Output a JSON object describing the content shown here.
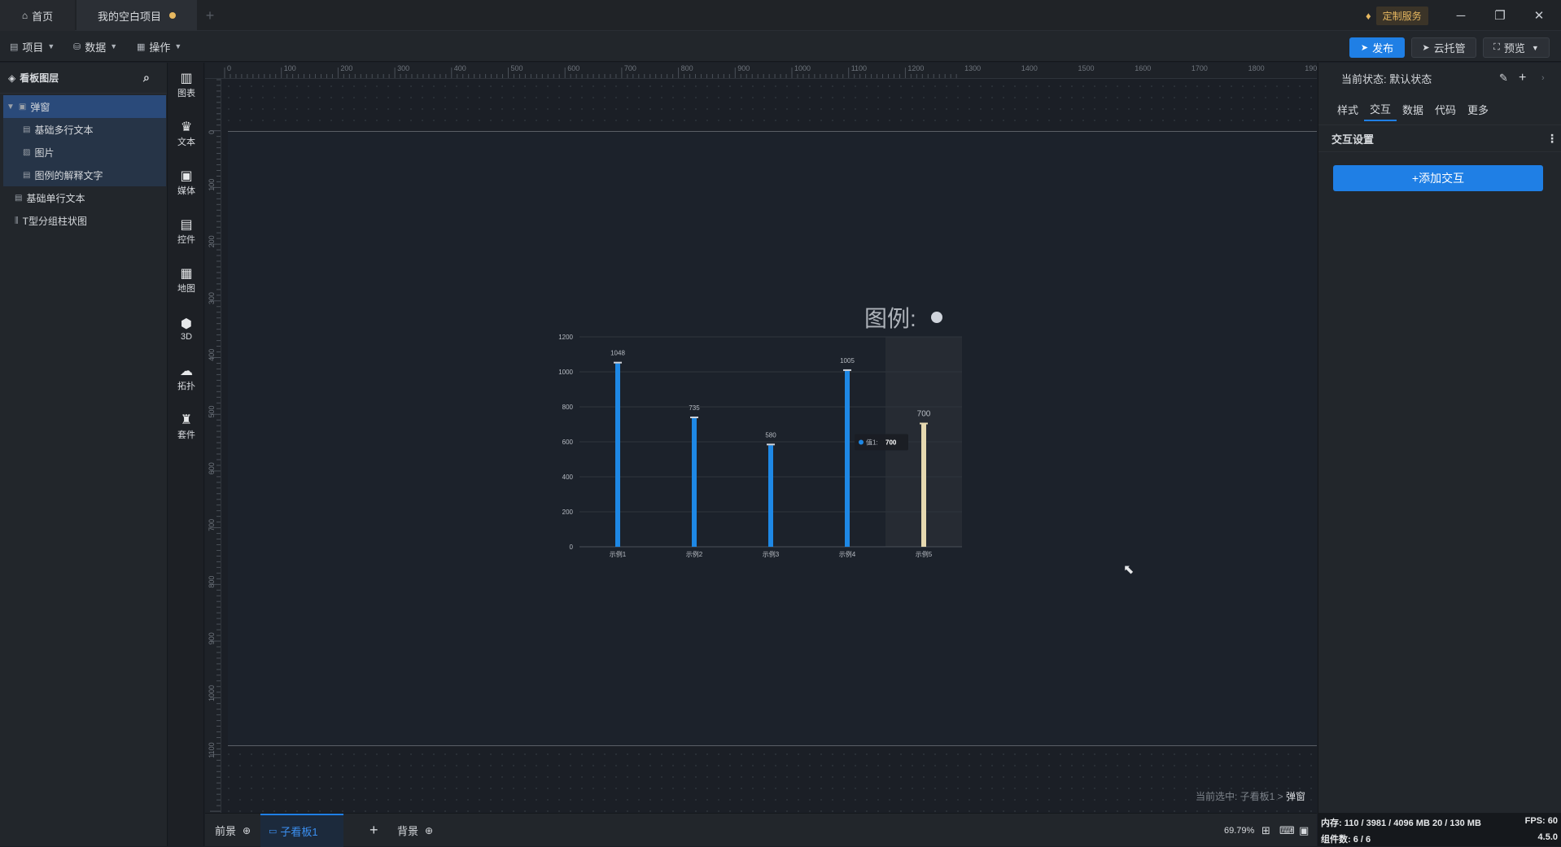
{
  "titlebar": {
    "home_label": "首页",
    "project_label": "我的空白项目",
    "add_tab": "+",
    "vip_label": "定制服务",
    "minimize": "─",
    "restore": "❐",
    "close": "✕"
  },
  "toolbar": {
    "menu_project": "项目",
    "menu_data": "数据",
    "menu_ops": "操作",
    "publish": "发布",
    "cloud": "云托管",
    "preview": "预览"
  },
  "layers": {
    "title": "看板图层",
    "items": [
      {
        "label": "弹窗"
      },
      {
        "label": "基础多行文本"
      },
      {
        "label": "图片"
      },
      {
        "label": "图例的解释文字"
      },
      {
        "label": "基础单行文本"
      },
      {
        "label": "T型分组柱状图"
      }
    ]
  },
  "rail": [
    {
      "label": "图表",
      "icon": "bar-chart-icon"
    },
    {
      "label": "文本",
      "icon": "crown-icon"
    },
    {
      "label": "媒体",
      "icon": "media-icon"
    },
    {
      "label": "控件",
      "icon": "widget-icon"
    },
    {
      "label": "地图",
      "icon": "map-icon"
    },
    {
      "label": "3D",
      "icon": "cube-icon"
    },
    {
      "label": "拓扑",
      "icon": "topology-icon"
    },
    {
      "label": "套件",
      "icon": "kit-icon"
    }
  ],
  "canvas": {
    "ruler_top_labels": [
      "0",
      "100",
      "200",
      "300",
      "400",
      "500",
      "600",
      "700",
      "800",
      "900",
      "1000",
      "1100",
      "1200",
      "1300",
      "1400",
      "1500",
      "1600",
      "1700",
      "1800",
      "1900"
    ],
    "ruler_left_labels": [
      "0",
      "100",
      "200",
      "300",
      "400",
      "500",
      "600",
      "700",
      "800",
      "900",
      "1000",
      "1100"
    ],
    "crumb_prefix": "当前选中: 子看板1 >",
    "crumb_current": "弹窗",
    "legend_title": "图例:"
  },
  "chart_data": {
    "type": "bar",
    "categories": [
      "示例1",
      "示例2",
      "示例3",
      "示例4",
      "示例5"
    ],
    "values": [
      1048,
      735,
      580,
      1005,
      700
    ],
    "ylim": [
      0,
      1200
    ],
    "yticks": [
      0,
      200,
      400,
      600,
      800,
      1000,
      1200
    ],
    "highlight_index": 4,
    "tooltip": {
      "label": "值1:",
      "value": "700"
    },
    "colors": {
      "bar": "#1e88e5",
      "highlight": "#e6d9b0",
      "grid": "#2f353d",
      "text": "#b7bcc3"
    }
  },
  "props": {
    "state_label": "当前状态:  默认状态",
    "tabs": [
      "样式",
      "交互",
      "数据",
      "代码",
      "更多"
    ],
    "active_tab": "交互",
    "section": "交互设置",
    "add_interaction": "+添加交互"
  },
  "bottombar": {
    "front": "前景",
    "sub_board": "子看板1",
    "add": "+",
    "back": "背景",
    "zoom": "69.79%"
  },
  "status": {
    "memory": "内存:  110 / 3981 / 4096 MB  20 / 130 MB",
    "fps": "FPS:  60",
    "components": "组件数: 6 / 6",
    "version": "4.5.0"
  }
}
